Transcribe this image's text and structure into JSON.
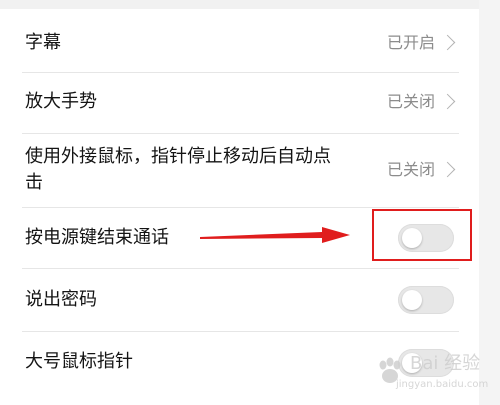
{
  "settings": {
    "items": [
      {
        "label": "字幕",
        "value": "已开启"
      },
      {
        "label": "放大手势",
        "value": "已关闭"
      },
      {
        "label": "使用外接鼠标，指针停止移动后自动点击",
        "value": "已关闭"
      },
      {
        "label": "按电源键结束通话",
        "toggle": false
      },
      {
        "label": "说出密码",
        "toggle": false
      },
      {
        "label": "大号鼠标指针",
        "toggle": false
      }
    ]
  },
  "icons": {
    "chevron": "chevron-right-icon",
    "annotation_arrow": "red-arrow-icon",
    "watermark_logo": "baidu-paw-icon"
  },
  "colors": {
    "annotation": "#e01d1d",
    "toggle_off": "#e7e7e7",
    "value_text": "#8c8c8c"
  },
  "watermark": {
    "title": "Bai 经验",
    "subtitle": "jingyan.baidu.com"
  }
}
